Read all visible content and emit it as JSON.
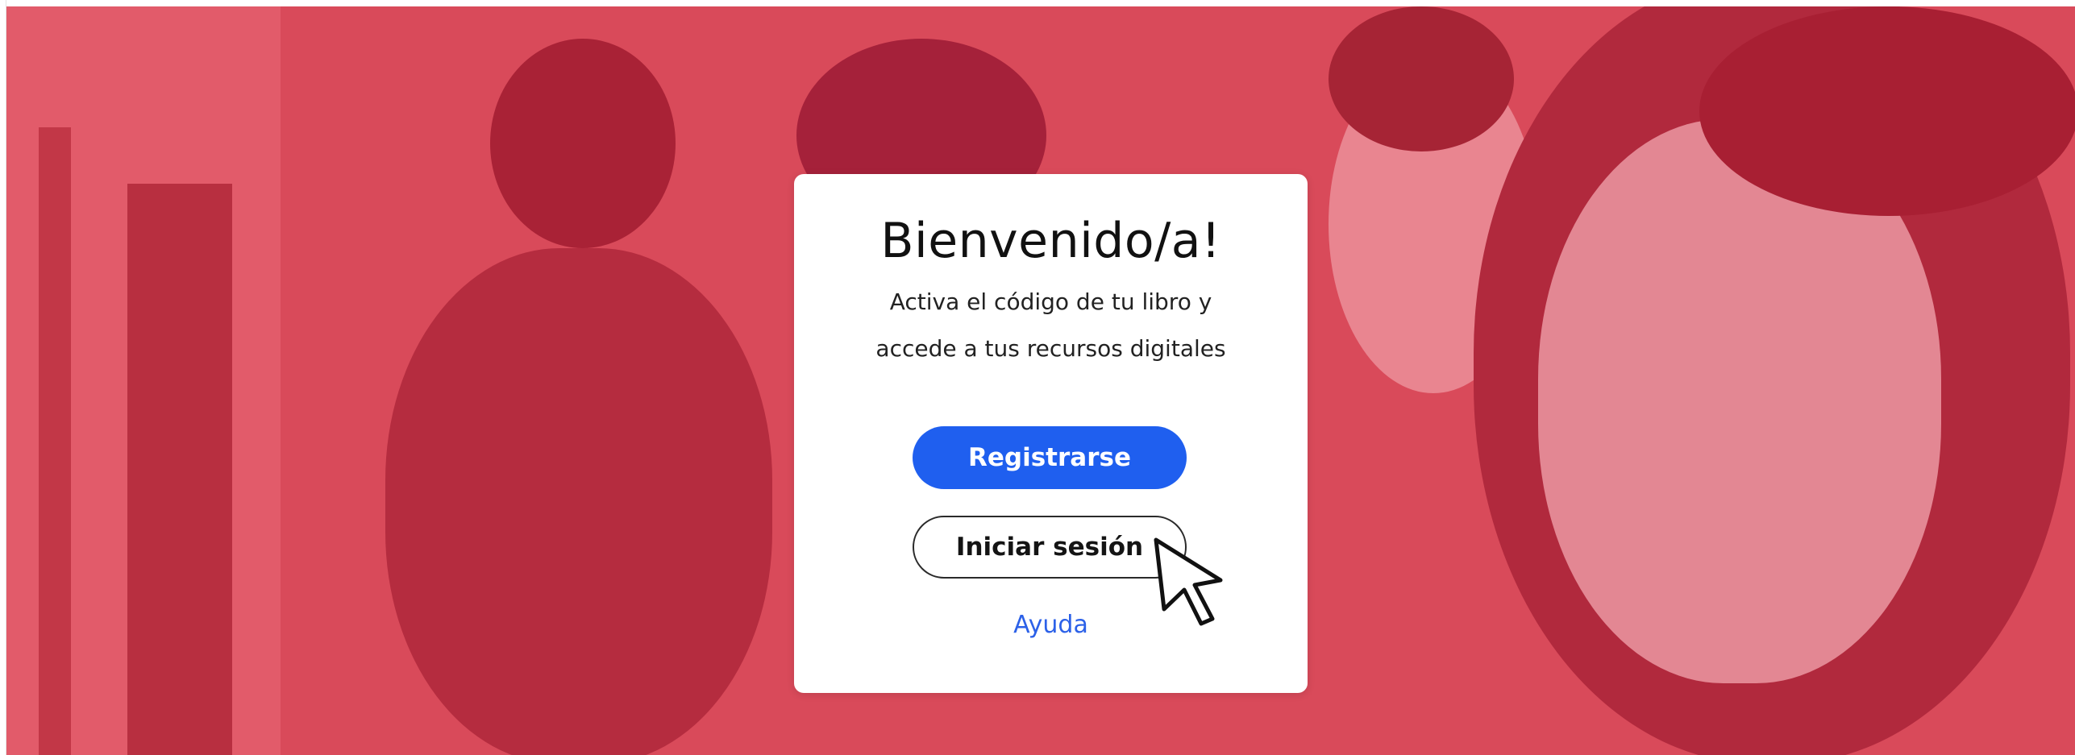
{
  "colors": {
    "overlay": "#d94a5a",
    "primary_button": "#1f5fef",
    "link": "#2c61e8",
    "card": "#ffffff"
  },
  "card": {
    "title": "Bienvenido/a!",
    "subtitle_line1": "Activa el código de tu libro y",
    "subtitle_line2": "accede a tus recursos digitales",
    "register_label": "Registrarse",
    "login_label": "Iniciar sesión",
    "help_label": "Ayuda"
  },
  "icons": {
    "cursor": "pointer-hand-cursor-icon"
  }
}
